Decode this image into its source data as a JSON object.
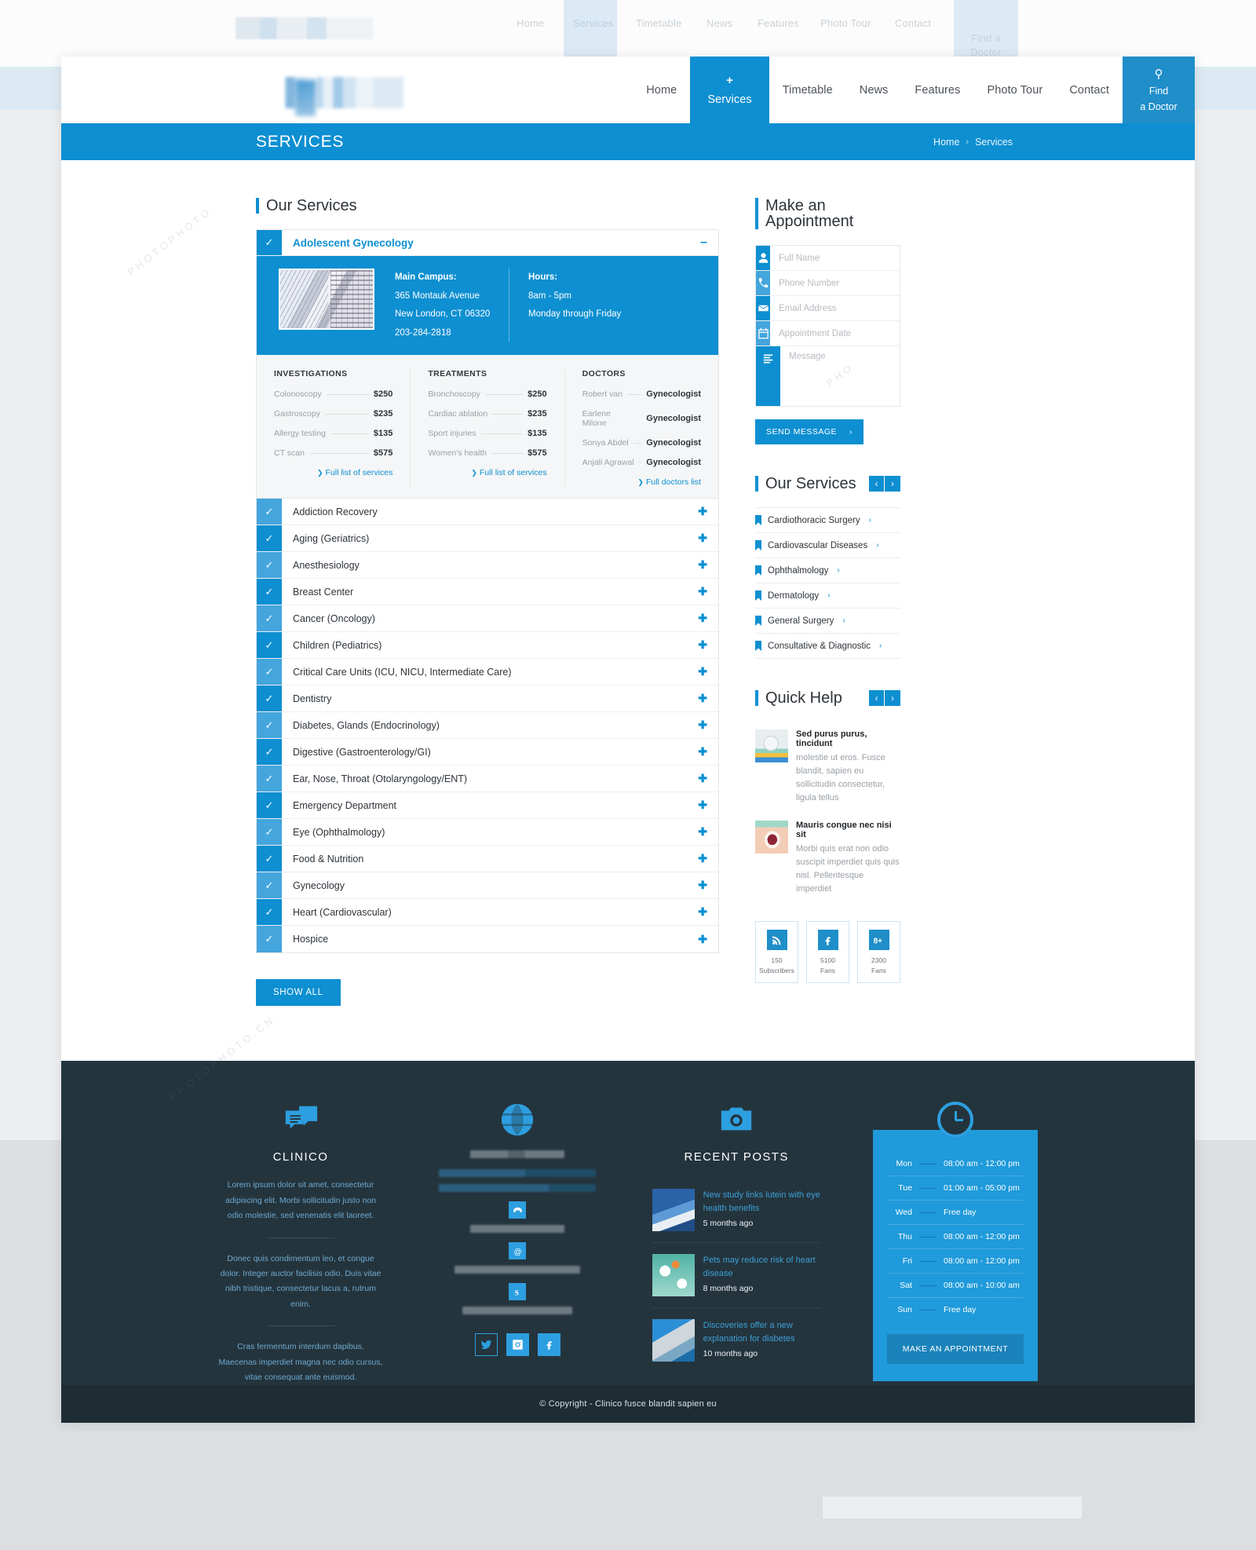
{
  "header": {
    "nav": [
      {
        "label": "Home",
        "active": false
      },
      {
        "label": "Services",
        "active": true
      },
      {
        "label": "Timetable",
        "active": false
      },
      {
        "label": "News",
        "active": false
      },
      {
        "label": "Features",
        "active": false
      },
      {
        "label": "Photo Tour",
        "active": false
      },
      {
        "label": "Contact",
        "active": false
      }
    ],
    "find_doctor_line1": "Find",
    "find_doctor_line2": "a Doctor",
    "services_plus": "+"
  },
  "title_bar": {
    "title": "SERVICES",
    "breadcrumb_home": "Home",
    "breadcrumb_sep": "›",
    "breadcrumb_current": "Services"
  },
  "main": {
    "heading": "Our Services",
    "open_item": {
      "title": "Adolescent Gynecology",
      "collapse_glyph": "–",
      "check_glyph": "✓",
      "campus_label": "Main Campus:",
      "campus_line1": "365 Montauk Avenue",
      "campus_line2": "New London, CT 06320",
      "campus_phone": "203-284-2818",
      "hours_label": "Hours:",
      "hours_line1": "8am - 5pm",
      "hours_line2": "Monday through Friday",
      "columns": [
        {
          "heading": "INVESTIGATIONS",
          "rows": [
            {
              "name": "Colonoscopy",
              "value": "$250"
            },
            {
              "name": "Gastroscopy",
              "value": "$235"
            },
            {
              "name": "Allergy testing",
              "value": "$135"
            },
            {
              "name": "CT scan",
              "value": "$575"
            }
          ],
          "link": "Full list of services"
        },
        {
          "heading": "TREATMENTS",
          "rows": [
            {
              "name": "Bronchoscopy",
              "value": "$250"
            },
            {
              "name": "Cardiac ablation",
              "value": "$235"
            },
            {
              "name": "Sport injuries",
              "value": "$135"
            },
            {
              "name": "Women's health",
              "value": "$575"
            }
          ],
          "link": "Full list of services"
        },
        {
          "heading": "DOCTORS",
          "rows": [
            {
              "name": "Robert van",
              "value": "Gynecologist"
            },
            {
              "name": "Earlene Milone",
              "value": "Gynecologist"
            },
            {
              "name": "Sonya Abdel",
              "value": "Gynecologist"
            },
            {
              "name": "Anjali Agrawal",
              "value": "Gynecologist"
            }
          ],
          "link": "Full doctors list"
        }
      ]
    },
    "closed_items": [
      "Addiction Recovery",
      "Aging (Geriatrics)",
      "Anesthesiology",
      "Breast Center",
      "Cancer (Oncology)",
      "Children (Pediatrics)",
      "Critical Care Units (ICU, NICU, Intermediate Care)",
      "Dentistry",
      "Diabetes, Glands (Endocrinology)",
      "Digestive (Gastroenterology/GI)",
      "Ear, Nose, Throat (Otolaryngology/ENT)",
      "Emergency Department",
      "Eye (Ophthalmology)",
      "Food & Nutrition",
      "Gynecology",
      "Heart (Cardiovascular)",
      "Hospice"
    ],
    "expand_glyph": "✚",
    "check_glyph": "✓",
    "show_all_label": "SHOW ALL"
  },
  "sidebar": {
    "appointment": {
      "heading": "Make an Appointment",
      "fields": [
        {
          "placeholder": "Full Name",
          "icon": "user-icon",
          "value": ""
        },
        {
          "placeholder": "Phone Number",
          "icon": "phone-icon",
          "value": ""
        },
        {
          "placeholder": "Email Address",
          "icon": "envelope-icon",
          "value": ""
        },
        {
          "placeholder": "Appointment Date",
          "icon": "calendar-icon",
          "value": ""
        }
      ],
      "message_placeholder": "Message",
      "message_icon": "lines-icon",
      "message_value": "",
      "send_label": "SEND MESSAGE",
      "send_chevron": "›"
    },
    "services": {
      "heading": "Our Services",
      "prev_glyph": "‹",
      "next_glyph": "›",
      "items": [
        "Cardiothoracic Surgery",
        "Cardiovascular Diseases",
        "Ophthalmology",
        "Dermatology",
        "General Surgery",
        "Consultative & Diagnostic"
      ],
      "item_chevron": "›"
    },
    "quick_help": {
      "heading": "Quick Help",
      "prev_glyph": "‹",
      "next_glyph": "›",
      "items": [
        {
          "title": "Sed purus purus, tincidunt",
          "text": "molestie ut eros. Fusce blandit, sapien eu sollicitudin consectetur, ligula tellus"
        },
        {
          "title": "Mauris congue nec nisi sit",
          "text": "Morbi quis erat non odio suscipit imperdiet quis quis nisl. Pellentesque imperdiet"
        }
      ]
    },
    "social": [
      {
        "icon": "rss-icon",
        "count": "150",
        "label": "Subscribers"
      },
      {
        "icon": "facebook-icon",
        "count": "5100",
        "label": "Fans"
      },
      {
        "icon": "google-plus-icon",
        "count": "2300",
        "label": "Fans"
      }
    ]
  },
  "footer": {
    "about": {
      "icon": "chat-bubbles-icon",
      "heading": "CLINICO",
      "paragraph1": "Lorem ipsum dolor sit amet, consectetur adipiscing elit. Morbi sollicitudin justo non odio molestie, sed venenatis elit laoreet.",
      "paragraph2": "Donec quis condimentum leo, et congue dolor. Integer auctor facilisis odio. Duis vitae nibh tristique, consectetur lacus a, rutrum enim.",
      "paragraph3": "Cras fermentum interdum dapibus. Maecenas imperdiet magna nec odio cursus, vitae consequat ante euismod."
    },
    "contact": {
      "icon": "globe-icon",
      "phone_icon": "phone-icon",
      "email_icon": "at-icon",
      "skype_icon": "skype-icon",
      "social": [
        {
          "icon": "twitter-icon",
          "filled": false
        },
        {
          "icon": "instagram-icon",
          "filled": true
        },
        {
          "icon": "facebook-icon",
          "filled": true
        }
      ]
    },
    "recent_posts": {
      "icon": "camera-icon",
      "heading": "RECENT POSTS",
      "items": [
        {
          "title": "New study links lutein with eye health benefits",
          "ago": "5 months ago"
        },
        {
          "title": "Pets may reduce risk of heart disease",
          "ago": "8 months ago"
        },
        {
          "title": "Discoveries offer a new explanation for diabetes",
          "ago": "10 months ago"
        }
      ]
    },
    "schedule": {
      "icon": "clock-icon",
      "rows": [
        {
          "day": "Mon",
          "hours": "08:00 am - 12:00 pm"
        },
        {
          "day": "Tue",
          "hours": "01:00 am - 05:00 pm"
        },
        {
          "day": "Wed",
          "hours": "Free day"
        },
        {
          "day": "Thu",
          "hours": "08:00 am - 12:00 pm"
        },
        {
          "day": "Fri",
          "hours": "08:00 am - 12:00 pm"
        },
        {
          "day": "Sat",
          "hours": "08:00 am - 10:00 am"
        },
        {
          "day": "Sun",
          "hours": "Free day"
        }
      ],
      "button_label": "MAKE AN APPOINTMENT"
    },
    "copyright": "© Copyright - Clinico  fusce blandit sapien eu"
  },
  "ghost_nav": [
    "Home",
    "Services",
    "Timetable",
    "News",
    "Features",
    "Photo Tour",
    "Contact"
  ],
  "ghost_find": "Find a Doctor",
  "colors": {
    "accent": "#0d8fd1",
    "accent_light": "#44a6dd",
    "footer_bg": "#24343d",
    "copyright_bg": "#1e2c34",
    "schedule_bg": "#1f9ada"
  }
}
